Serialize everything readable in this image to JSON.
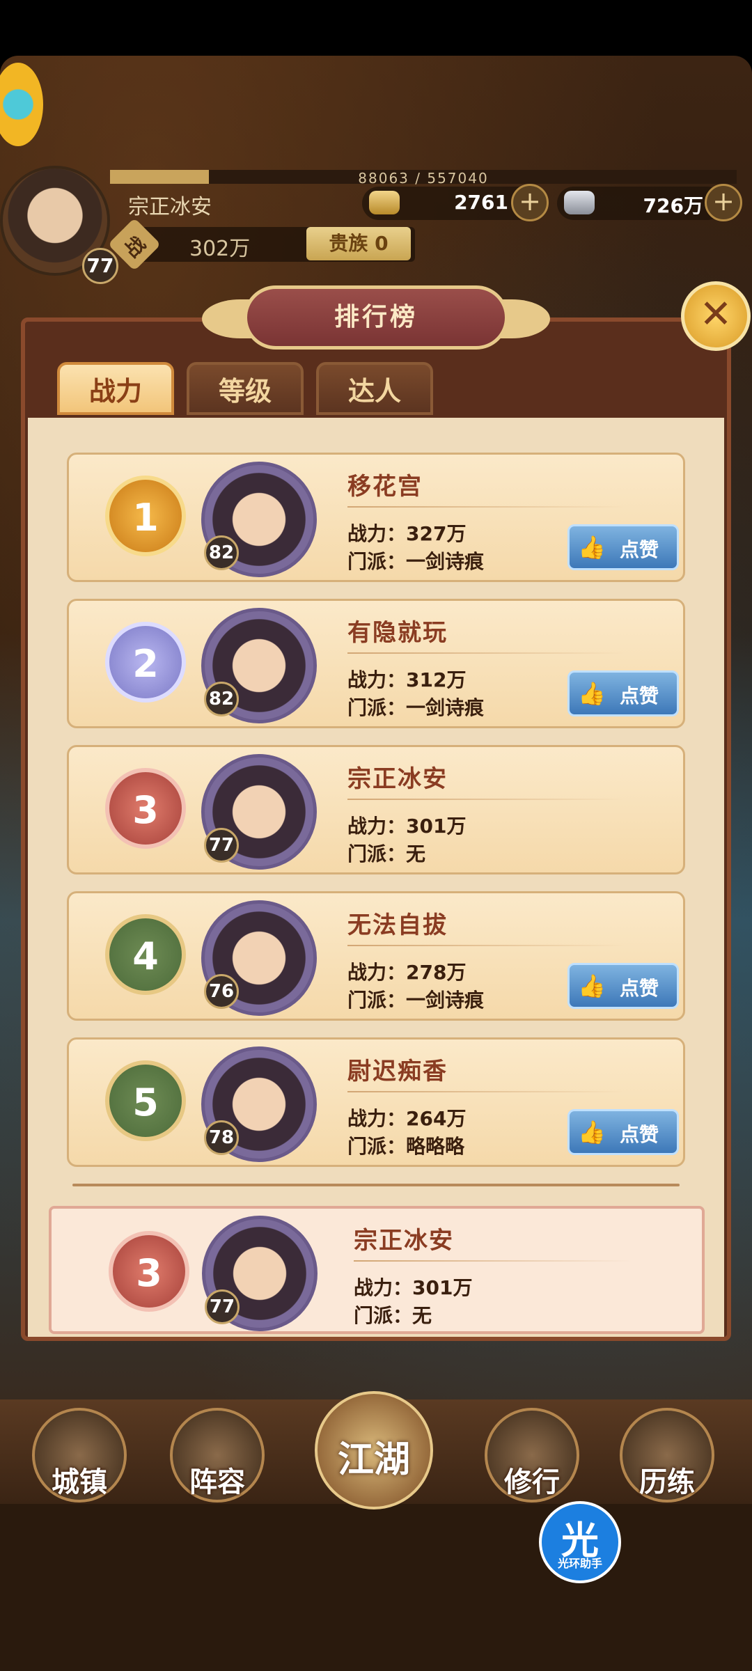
{
  "player": {
    "name": "宗正冰安",
    "level": "77",
    "exp_text": "88063 / 557040",
    "exp_fraction": 0.158,
    "currency_gold": "2761",
    "currency_silver": "726万",
    "power_badge": "战",
    "power": "302万",
    "noble": "贵族 0"
  },
  "panel": {
    "title": "排行榜",
    "close_icon": "close-icon",
    "tabs": [
      {
        "label": "战力",
        "active": true
      },
      {
        "label": "等级",
        "active": false
      },
      {
        "label": "达人",
        "active": false
      }
    ],
    "power_label": "战力：",
    "sect_label": "门派：",
    "like_label": "点赞"
  },
  "ranking": [
    {
      "rank": "1",
      "name": "移花宫",
      "level": "82",
      "power": "327万",
      "sect": "一剑诗痕",
      "likeable": true
    },
    {
      "rank": "2",
      "name": "有隐就玩",
      "level": "82",
      "power": "312万",
      "sect": "一剑诗痕",
      "likeable": true
    },
    {
      "rank": "3",
      "name": "宗正冰安",
      "level": "77",
      "power": "301万",
      "sect": "无",
      "likeable": false
    },
    {
      "rank": "4",
      "name": "无法自拔",
      "level": "76",
      "power": "278万",
      "sect": "一剑诗痕",
      "likeable": true
    },
    {
      "rank": "5",
      "name": "尉迟痴香",
      "level": "78",
      "power": "264万",
      "sect": "略略略",
      "likeable": true
    }
  ],
  "my_rank": {
    "rank": "3",
    "name": "宗正冰安",
    "level": "77",
    "power": "301万",
    "sect": "无"
  },
  "bottom_nav": [
    {
      "label": "城镇"
    },
    {
      "label": "阵容"
    },
    {
      "label": "江湖"
    },
    {
      "label": "修行"
    },
    {
      "label": "历练"
    }
  ],
  "assistant": {
    "glyph": "光",
    "label": "光环助手"
  }
}
